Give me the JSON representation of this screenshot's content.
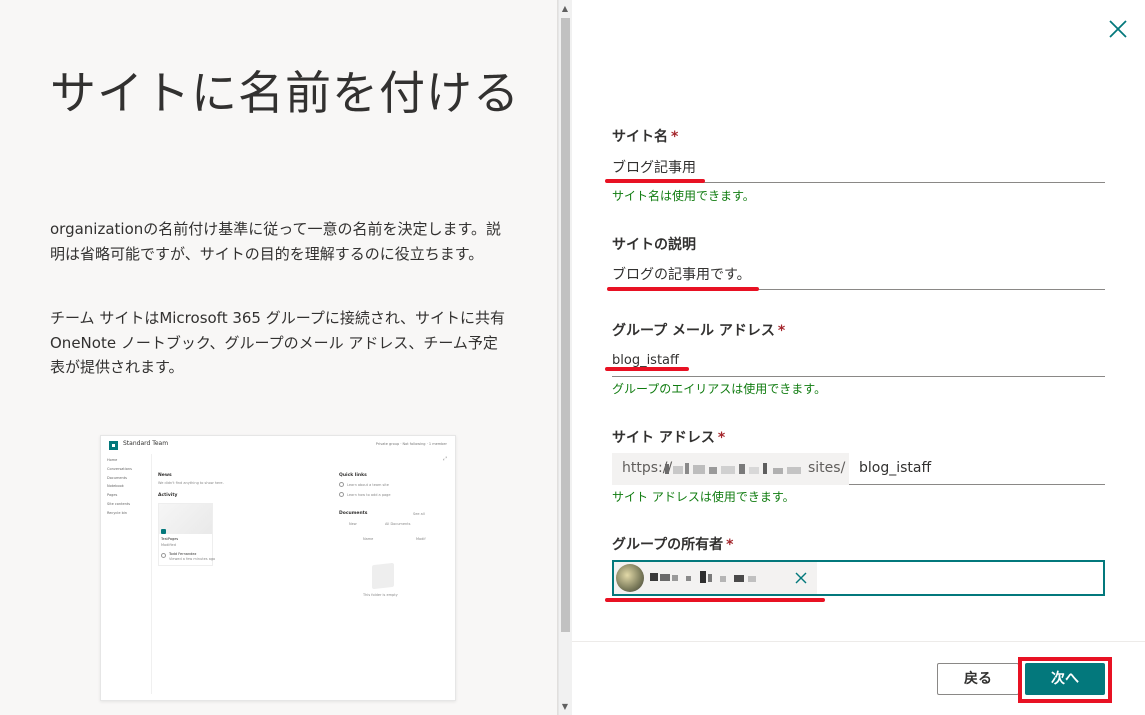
{
  "left": {
    "title": "サイトに名前を付ける",
    "description1": "organizationの名前付け基準に従って一意の名前を決定します。説明は省略可能ですが、サイトの目的を理解するのに役立ちます。",
    "description2": "チーム サイトはMicrosoft 365 グループに接続され、サイトに共有 OneNote ノートブック、グループのメール アドレス、チーム予定表が提供されます。",
    "preview": {
      "site_title": "Standard Team",
      "top_right": "Private group · Not following · 1 member",
      "nav": [
        "Home",
        "Conversations",
        "Documents",
        "Notebook",
        "Pages",
        "Site contents",
        "Recycle bin"
      ],
      "news_heading": "News",
      "news_empty": "We didn't find anything to show here.",
      "activity_heading": "Activity",
      "activity_item": "TestPages",
      "activity_sub": "Modified",
      "activity_user": "Todd Fernandez",
      "activity_user_sub": "Viewed a few minutes ago",
      "quick_links_heading": "Quick links",
      "quick_link_1": "Learn about a team site",
      "quick_link_2": "Learn how to add a page",
      "documents_heading": "Documents",
      "see_all": "See all",
      "new_label": "New",
      "all_documents": "All Documents",
      "name_col": "Name",
      "modified_col": "Modif",
      "empty_folder": "This folder is empty"
    }
  },
  "form": {
    "site_name": {
      "label": "サイト名",
      "required": "*",
      "value": "ブログ記事用",
      "message": "サイト名は使用できます。"
    },
    "site_description": {
      "label": "サイトの説明",
      "value": "ブログの記事用です。"
    },
    "group_email": {
      "label": "グループ メール アドレス",
      "required": "*",
      "value": "blog_istaff",
      "message": "グループのエイリアスは使用できます。"
    },
    "site_address": {
      "label": "サイト アドレス",
      "required": "*",
      "prefix": "https://",
      "sites_segment": "sites/",
      "value": "blog_istaff",
      "message": "サイト アドレスは使用できます。"
    },
    "group_owner": {
      "label": "グループの所有者",
      "required": "*"
    }
  },
  "buttons": {
    "back": "戻る",
    "next": "次へ"
  },
  "colors": {
    "accent": "#03787c",
    "success": "#107c10",
    "required": "#a4262c",
    "annotation": "#e81123"
  }
}
